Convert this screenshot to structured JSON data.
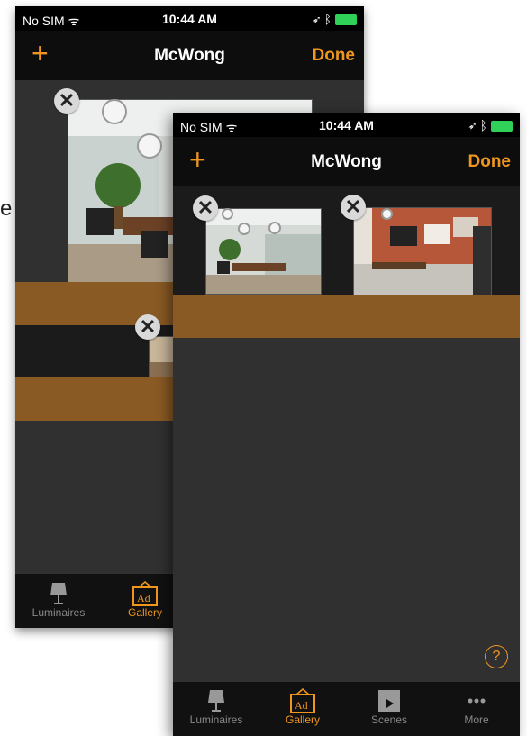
{
  "status": {
    "carrier": "No SIM",
    "time": "10:44 AM"
  },
  "navbar": {
    "title": "McWong",
    "done_label": "Done",
    "add_symbol": "+"
  },
  "close_symbol": "✕",
  "help_symbol": "?",
  "side_letter": "e",
  "tabs": [
    {
      "label": "Luminaires",
      "icon": "lamp-icon",
      "active": false
    },
    {
      "label": "Gallery",
      "icon": "gallery-icon",
      "active": true
    },
    {
      "label": "Scenes",
      "icon": "scenes-icon",
      "active": false
    },
    {
      "label": "More",
      "icon": "more-icon",
      "active": false
    }
  ],
  "colors": {
    "accent": "#f0961e",
    "room_band": "#8a5a24",
    "background": "#2b2b2b",
    "battery": "#30d158"
  }
}
